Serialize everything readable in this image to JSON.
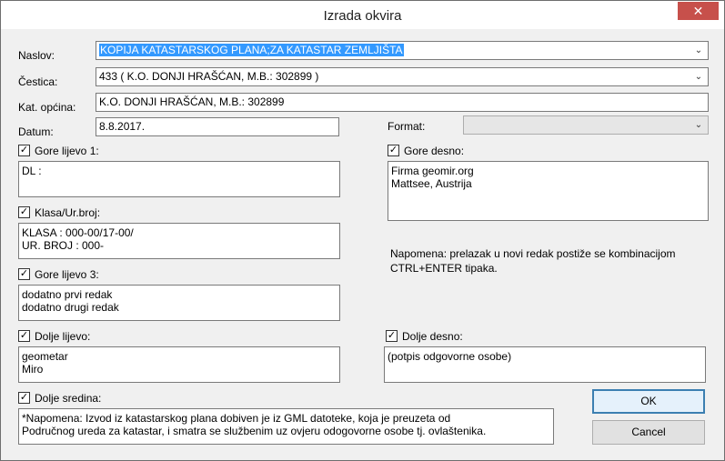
{
  "window": {
    "title": "Izrada okvira",
    "close_glyph": "✕"
  },
  "fields": {
    "naslov": {
      "label": "Naslov:",
      "value": "KOPIJA KATASTARSKOG PLANA;ZA KATASTAR ZEMLJIŠTA"
    },
    "cestica": {
      "label": "Čestica:",
      "value": "433 ( K.O. DONJI HRAŠĆAN, M.B.: 302899 )"
    },
    "kat_opcina": {
      "label": "Kat. općina:",
      "value": "K.O. DONJI HRAŠĆAN, M.B.: 302899"
    },
    "datum": {
      "label": "Datum:",
      "value": "8.8.2017."
    },
    "format": {
      "label": "Format:",
      "value": ""
    }
  },
  "checkbox_mark": "✓",
  "chevron": "⌄",
  "sections": {
    "gore_lijevo": {
      "label": "Gore lijevo 1:",
      "checked": true,
      "lines": [
        "DL :"
      ]
    },
    "gore_desno": {
      "label": "Gore desno:",
      "checked": true,
      "lines": [
        "Firma geomir.org",
        "Mattsee, Austrija"
      ]
    },
    "klasa": {
      "label": "Klasa/Ur.broj:",
      "checked": true,
      "lines": [
        "KLASA : 000-00/17-00/",
        "UR. BROJ : 000-"
      ]
    },
    "gore_lijevo3": {
      "label": "Gore lijevo 3:",
      "checked": true,
      "lines": [
        "dodatno prvi redak",
        "dodatno drugi redak"
      ]
    },
    "dolje_lijevo": {
      "label": "Dolje lijevo:",
      "checked": true,
      "lines": [
        "geometar",
        "Miro"
      ]
    },
    "dolje_desno": {
      "label": "Dolje desno:",
      "checked": true,
      "lines": [
        "(potpis odgovorne osobe)"
      ]
    },
    "dolje_sredina": {
      "label": "Dolje sredina:",
      "checked": true,
      "lines": [
        "*Napomena: Izvod iz katastarskog plana dobiven je iz GML datoteke, koja je preuzeta od",
        "Područnog ureda za katastar, i smatra se službenim uz ovjeru odogovorne osobe tj. ovlaštenika."
      ]
    }
  },
  "note": {
    "line1": "Napomena: prelazak u novi redak postiže se kombinacijom",
    "line2": "CTRL+ENTER tipaka."
  },
  "buttons": {
    "ok": "OK",
    "cancel": "Cancel"
  }
}
